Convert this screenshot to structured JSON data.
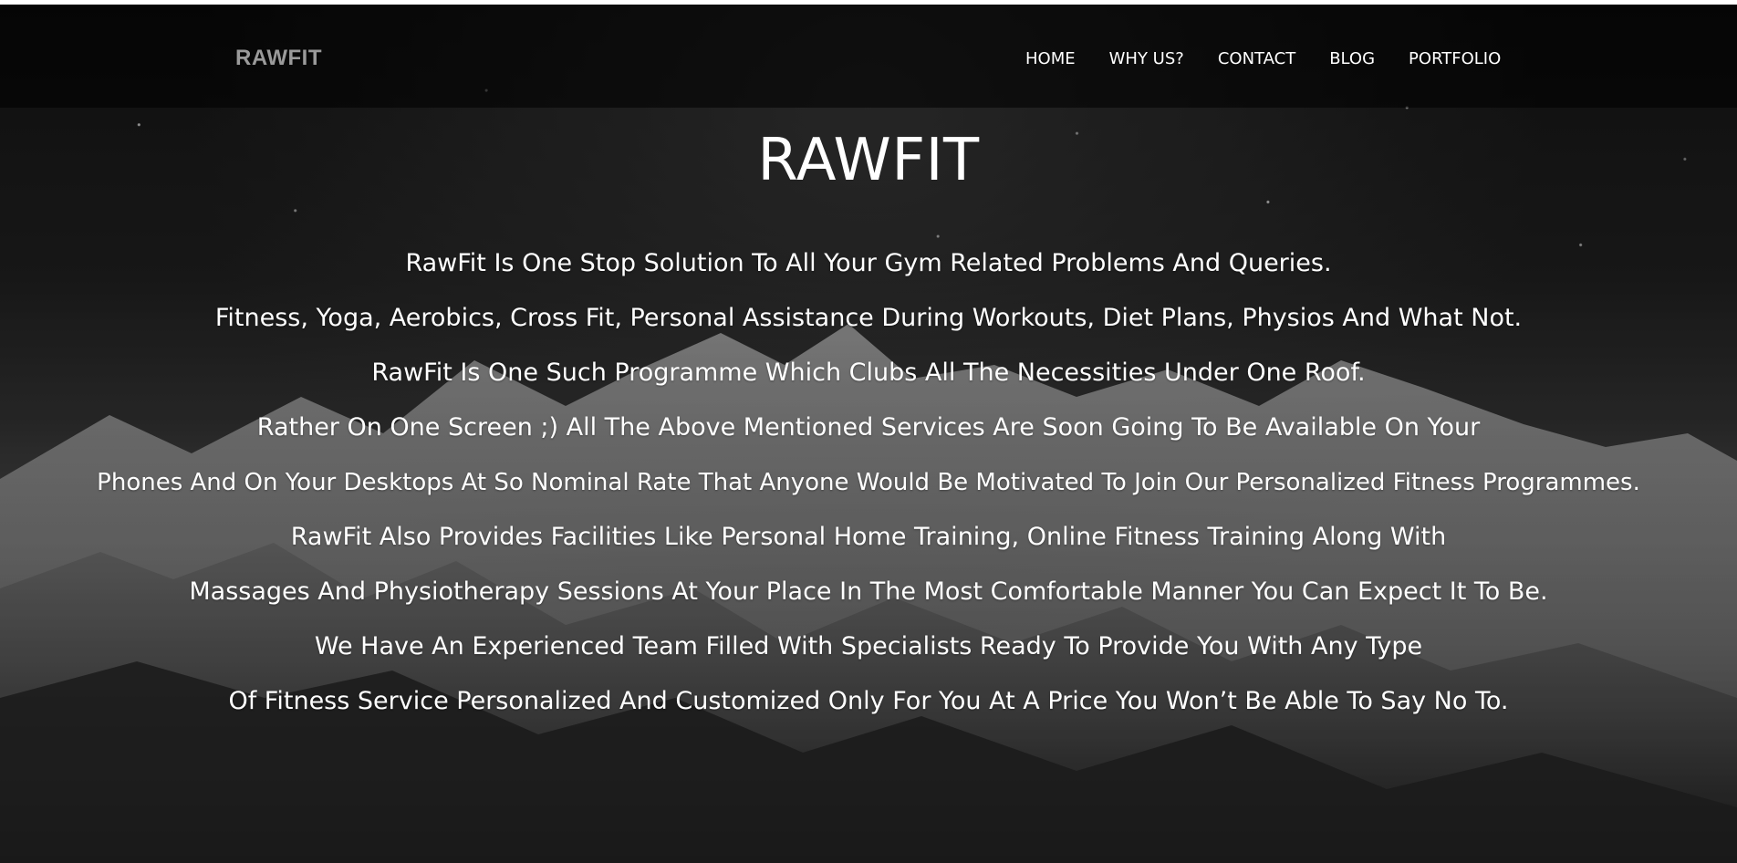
{
  "brand": "RAWFIT",
  "nav": [
    "HOME",
    "WHY US?",
    "CONTACT",
    "BLOG",
    "PORTFOLIO"
  ],
  "hero": {
    "title": "RAWFIT",
    "lines": [
      "RawFit Is One Stop Solution To All Your Gym Related Problems And Queries.",
      "Fitness, Yoga, Aerobics, Cross Fit, Personal Assistance During Workouts, Diet Plans, Physios And What Not.",
      "RawFit Is One Such Programme Which Clubs All The Necessities Under One Roof.",
      "Rather On One Screen ;) All The Above Mentioned Services Are Soon Going To Be Available On Your",
      "Phones And On Your Desktops At So Nominal Rate That Anyone Would Be Motivated To Join Our Personalized Fitness Programmes.",
      "RawFit Also Provides Facilities Like Personal Home Training, Online Fitness Training Along With",
      "Massages And Physiotherapy Sessions At Your Place In The Most Comfortable Manner You Can Expect It To Be.",
      "We Have An Experienced Team Filled With Specialists Ready To Provide You With Any Type",
      "Of Fitness Service Personalized And Customized Only For You At A Price You Won’t Be Able To Say No To."
    ]
  },
  "colors": {
    "navbar": "#000000",
    "brand": "#9a9a9a",
    "text": "#ffffff"
  }
}
